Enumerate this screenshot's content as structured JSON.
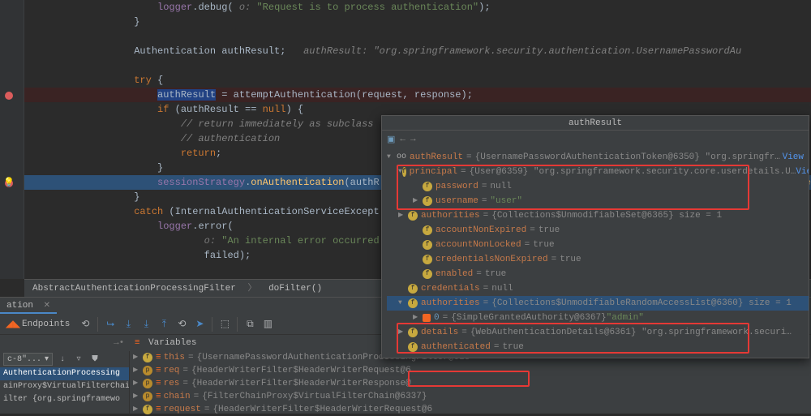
{
  "editor": {
    "lines": [
      {
        "indent": 5,
        "frags": [
          {
            "cls": "field",
            "t": "logger"
          },
          {
            "cls": "ident",
            "t": ".debug( "
          },
          {
            "cls": "param",
            "t": "o: "
          },
          {
            "cls": "str",
            "t": "\"Request is to process authentication\""
          },
          {
            "cls": "ident",
            "t": ");"
          }
        ]
      },
      {
        "indent": 4,
        "frags": [
          {
            "cls": "ident",
            "t": "}"
          }
        ]
      },
      {
        "indent": 0,
        "frags": []
      },
      {
        "indent": 4,
        "frags": [
          {
            "cls": "ident",
            "t": "Authentication authResult;   "
          },
          {
            "cls": "comment",
            "t": "authResult: \"org.springframework.security.authentication.UsernamePasswordAu"
          }
        ]
      },
      {
        "indent": 0,
        "frags": []
      },
      {
        "indent": 4,
        "frags": [
          {
            "cls": "kw",
            "t": "try"
          },
          {
            "cls": "ident",
            "t": " {"
          }
        ]
      },
      {
        "indent": 5,
        "frags": [
          {
            "cls": "boxed",
            "t": "authResult"
          },
          {
            "cls": "ident",
            "t": " = attemptAuthentication(request, response);"
          }
        ],
        "bp": true
      },
      {
        "indent": 5,
        "frags": [
          {
            "cls": "kw",
            "t": "if"
          },
          {
            "cls": "ident",
            "t": " (authResult == "
          },
          {
            "cls": "kw",
            "t": "null"
          },
          {
            "cls": "ident",
            "t": ") {"
          }
        ]
      },
      {
        "indent": 6,
        "frags": [
          {
            "cls": "comment",
            "t": "// return immediately as subclass "
          }
        ]
      },
      {
        "indent": 6,
        "frags": [
          {
            "cls": "comment",
            "t": "// authentication"
          }
        ]
      },
      {
        "indent": 6,
        "frags": [
          {
            "cls": "kw",
            "t": "return"
          },
          {
            "cls": "ident",
            "t": ";"
          }
        ]
      },
      {
        "indent": 5,
        "frags": [
          {
            "cls": "ident",
            "t": "}"
          }
        ]
      },
      {
        "indent": 5,
        "frags": [
          {
            "cls": "field",
            "t": "sessionStrategy"
          },
          {
            "cls": "ident",
            "t": "."
          },
          {
            "cls": "method",
            "t": "onAuthentication"
          },
          {
            "cls": "ident",
            "t": "(authR"
          }
        ],
        "hl": true
      },
      {
        "indent": 4,
        "frags": [
          {
            "cls": "ident",
            "t": "}"
          }
        ]
      },
      {
        "indent": 4,
        "frags": [
          {
            "cls": "kw",
            "t": "catch"
          },
          {
            "cls": "ident",
            "t": " (InternalAuthenticationServiceExcept"
          }
        ]
      },
      {
        "indent": 5,
        "frags": [
          {
            "cls": "field",
            "t": "logger"
          },
          {
            "cls": "ident",
            "t": ".error("
          }
        ]
      },
      {
        "indent": 7,
        "frags": [
          {
            "cls": "param",
            "t": "o: "
          },
          {
            "cls": "str",
            "t": "\"An internal error occurred "
          }
        ]
      },
      {
        "indent": 7,
        "frags": [
          {
            "cls": "ident",
            "t": "failed);"
          }
        ]
      }
    ],
    "trailing_hl": "gframe"
  },
  "breadcrumb": {
    "items": [
      "AbstractAuthenticationProcessingFilter",
      "doFilter()"
    ]
  },
  "debug": {
    "tab_label": "ation",
    "endpoints_label": "Endpoints",
    "variables_label": "Variables",
    "thread_combo": "c-8\"...",
    "frames": [
      {
        "text": "AuthenticationProcessing",
        "sel": true
      },
      {
        "text": "ainProxy$VirtualFilterChai"
      },
      {
        "text": "ilter {org.springframewo"
      }
    ],
    "vars": [
      {
        "kind": "f",
        "name": "this",
        "value": "{UsernamePasswordAuthenticationProcessingFilter@613"
      },
      {
        "kind": "p",
        "name": "req",
        "value": "{HeaderWriterFilter$HeaderWriterRequest@6"
      },
      {
        "kind": "p",
        "name": "res",
        "value": "{HeaderWriterFilter$HeaderWriterResponse@"
      },
      {
        "kind": "p",
        "name": "chain",
        "value": "{FilterChainProxy$VirtualFilterChain@6337}"
      },
      {
        "kind": "f",
        "name": "request",
        "value": "{HeaderWriterFilter$HeaderWriterRequest@6"
      }
    ]
  },
  "popup": {
    "title": "authResult",
    "tree": [
      {
        "depth": 0,
        "exp": "▼",
        "icon": "oo",
        "name": "authResult",
        "eq": true,
        "value": "{UsernamePasswordAuthenticationToken@6350} \"org.springfr…",
        "link": "View"
      },
      {
        "depth": 1,
        "exp": "▼",
        "icon": "f",
        "name": "principal",
        "eq": true,
        "value": "{User@6359} \"org.springframework.security.core.userdetails.U…",
        "link": "View"
      },
      {
        "depth": 2,
        "exp": "",
        "icon": "f",
        "name": "password",
        "eq": true,
        "value": "null"
      },
      {
        "depth": 2,
        "exp": "▶",
        "icon": "f",
        "name": "username",
        "eq": true,
        "valueStr": "\"user\""
      },
      {
        "depth": 1,
        "exp": "▶",
        "icon": "f",
        "name": "authorities",
        "eq": true,
        "value": "{Collections$UnmodifiableSet@6365}  size = 1"
      },
      {
        "depth": 2,
        "exp": "",
        "icon": "f",
        "name": "accountNonExpired",
        "eq": true,
        "value": "true"
      },
      {
        "depth": 2,
        "exp": "",
        "icon": "f",
        "name": "accountNonLocked",
        "eq": true,
        "value": "true"
      },
      {
        "depth": 2,
        "exp": "",
        "icon": "f",
        "name": "credentialsNonExpired",
        "eq": true,
        "value": "true"
      },
      {
        "depth": 2,
        "exp": "",
        "icon": "f",
        "name": "enabled",
        "eq": true,
        "value": "true"
      },
      {
        "depth": 1,
        "exp": "",
        "icon": "f",
        "name": "credentials",
        "eq": true,
        "value": "null"
      },
      {
        "depth": 1,
        "exp": "▼",
        "icon": "f",
        "name": "authorities",
        "eq": true,
        "value": "{Collections$UnmodifiableRandomAccessList@6360}  size = 1",
        "sel": true
      },
      {
        "depth": 2,
        "exp": "▶",
        "icon": "k",
        "name": "0",
        "nameBlue": true,
        "eq": true,
        "value": "{SimpleGrantedAuthority@6367} ",
        "valueStr": "\"admin\""
      },
      {
        "depth": 1,
        "exp": "▶",
        "icon": "f",
        "name": "details",
        "eq": true,
        "value": "{WebAuthenticationDetails@6361} \"org.springframework.securi…"
      },
      {
        "depth": 1,
        "exp": "",
        "icon": "f",
        "name": "authenticated",
        "eq": true,
        "value": "true"
      }
    ]
  }
}
